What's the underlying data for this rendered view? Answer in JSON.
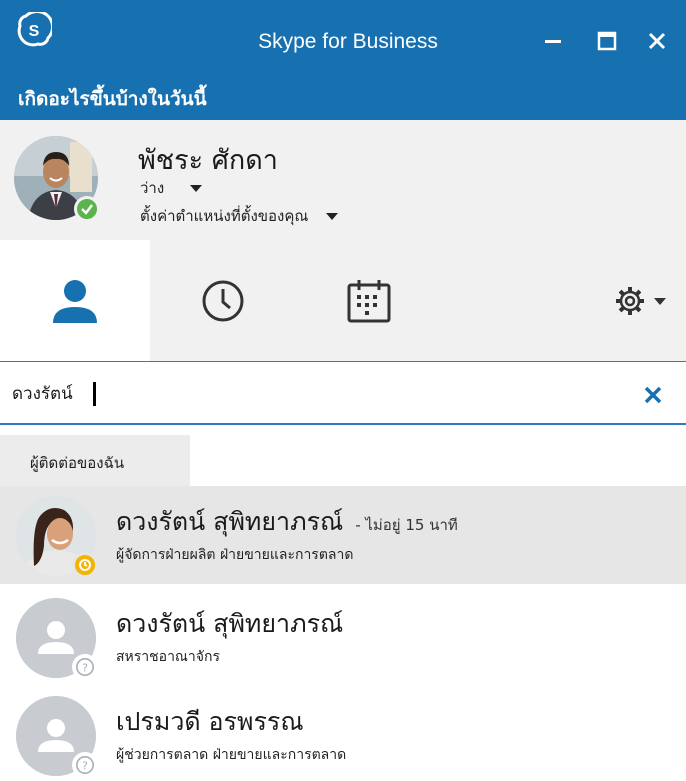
{
  "app": {
    "title": "Skype for Business",
    "whats_happening": "เกิดอะไรขึ้นบ้างในวันนี้"
  },
  "profile": {
    "name": "พัชระ ศักดา",
    "status": "ว่าง",
    "location": "ตั้งค่าตำแหน่งที่ตั้งของคุณ",
    "presence_color": "#59b44b"
  },
  "tabs": [
    {
      "id": "contacts",
      "icon": "person-icon",
      "active": true
    },
    {
      "id": "recent",
      "icon": "clock-icon"
    },
    {
      "id": "meetings",
      "icon": "calendar-icon"
    },
    {
      "id": "settings",
      "icon": "gear-icon"
    }
  ],
  "search": {
    "value": "ดวงรัตน์",
    "clear_icon": "close-icon"
  },
  "group": {
    "label": "ผู้ติดต่อของฉัน"
  },
  "contacts": [
    {
      "name": "ดวงรัตน์ สุพิทยาภรณ์",
      "note": "- ไม่อยู่ 15 นาที",
      "title": "ผู้จัดการฝ่ายผลิต ฝ่ายขายและการตลาด",
      "presence": "away",
      "presence_color": "#f5b400",
      "selected": true
    },
    {
      "name": "ดวงรัตน์ สุพิทยาภรณ์",
      "note": "",
      "title": "สหราชอาณาจักร",
      "presence": "unknown",
      "selected": false
    },
    {
      "name": "เปรมวดี อรพรรณ",
      "note": "",
      "title": "ผู้ช่วยการตลาด ฝ่ายขายและการตลาด",
      "presence": "unknown",
      "selected": false
    }
  ],
  "colors": {
    "brand": "#1770b0",
    "accent": "#2b7cc3"
  }
}
